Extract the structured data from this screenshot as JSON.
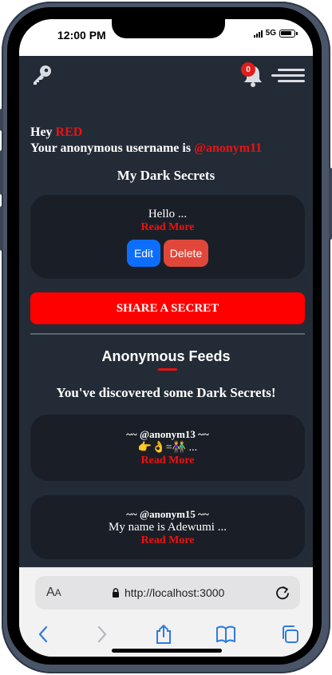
{
  "status": {
    "time": "12:00 PM",
    "network": "5G"
  },
  "app": {
    "notification_count": "0",
    "greeting_prefix": "Hey ",
    "user_name": "RED",
    "anon_label": "Your anonymous username is ",
    "anon_username": "@anonym11",
    "my_secrets_title": "My Dark Secrets",
    "my_secret": {
      "text": "Hello ...",
      "read_more": "Read More",
      "edit_label": "Edit",
      "delete_label": "Delete"
    },
    "share_button": "SHARE A SECRET",
    "feeds_title": "Anonymous Feeds",
    "discovered_text": "You've discovered some Dark Secrets!",
    "feeds": [
      {
        "user": "~~ @anonym13 ~~",
        "text": "👉👌=👫 ...",
        "read_more": "Read More"
      },
      {
        "user": "~~ @anonym15 ~~",
        "text": "My name is Adewumi ...",
        "read_more": "Read More"
      }
    ]
  },
  "browser": {
    "aa_big": "A",
    "aa_small": "A",
    "url": "http://localhost:3000"
  },
  "colors": {
    "background": "#232b36",
    "card": "#1a1f27",
    "accent_red": "#ee1111",
    "edit_blue": "#0d6efd",
    "delete_red": "#e0473a"
  }
}
